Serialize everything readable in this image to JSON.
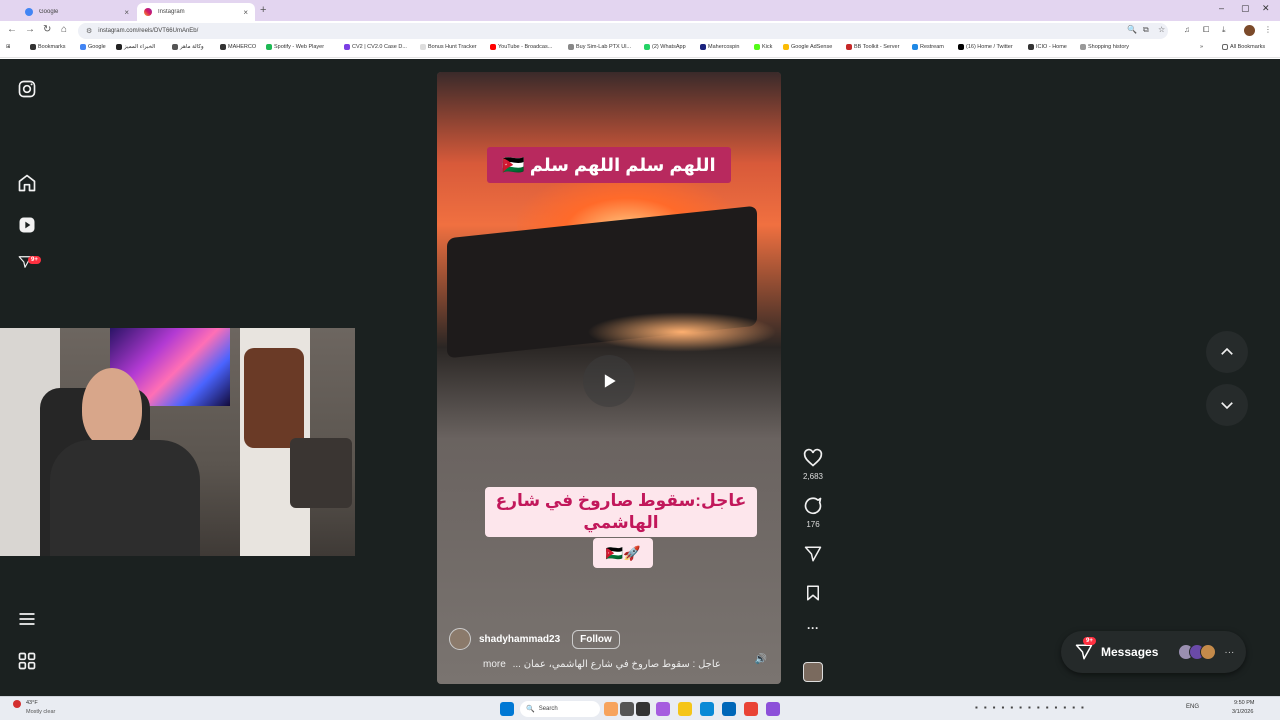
{
  "browser": {
    "tabs": [
      {
        "title": "Google",
        "active": false
      },
      {
        "title": "Instagram",
        "active": true
      }
    ],
    "url": "instagram.com/reels/DVT66UmAnEb/",
    "bookmarks": [
      "Bookmarks",
      "Google",
      "الخبراء المميز",
      "وكالة ماهر",
      "MAHERCO",
      "Spotify - Web Player",
      "CV2 | CV2.0 Case D...",
      "Bonus Hunt Tracker",
      "YouTube - Broadcas...",
      "Buy Sim-Lab PTX Ul...",
      "(2) WhatsApp",
      "Mahercospin",
      "Kick",
      "Google AdSense",
      "BB Toolkit - Server",
      "Restream",
      "(16) Home / Twitter",
      "ICIO - Home",
      "Shopping history"
    ],
    "all_bookmarks": "All Bookmarks"
  },
  "instagram": {
    "notifications_badge": "9+",
    "reel": {
      "top_text": "اللهم سلم اللهم سلم 🇯🇴",
      "bottom_text": "عاجل:سقوط صاروخ في شارع الهاشمي",
      "bottom_flags": "🇯🇴🚀",
      "author": "shadyhammad23",
      "follow_label": "Follow",
      "caption": "عاجل : سقوط صاروخ في شارع الهاشمي، عمان ...",
      "caption_more": "more"
    },
    "actions": {
      "likes": "2,683",
      "comments": "176"
    },
    "messages": {
      "label": "Messages",
      "badge": "9+"
    }
  },
  "taskbar": {
    "weather_temp": "43°F",
    "weather_desc": "Mostly clear",
    "search_placeholder": "Search",
    "lang": "ENG",
    "time": "9:50 PM",
    "date": "3/1/2026"
  }
}
